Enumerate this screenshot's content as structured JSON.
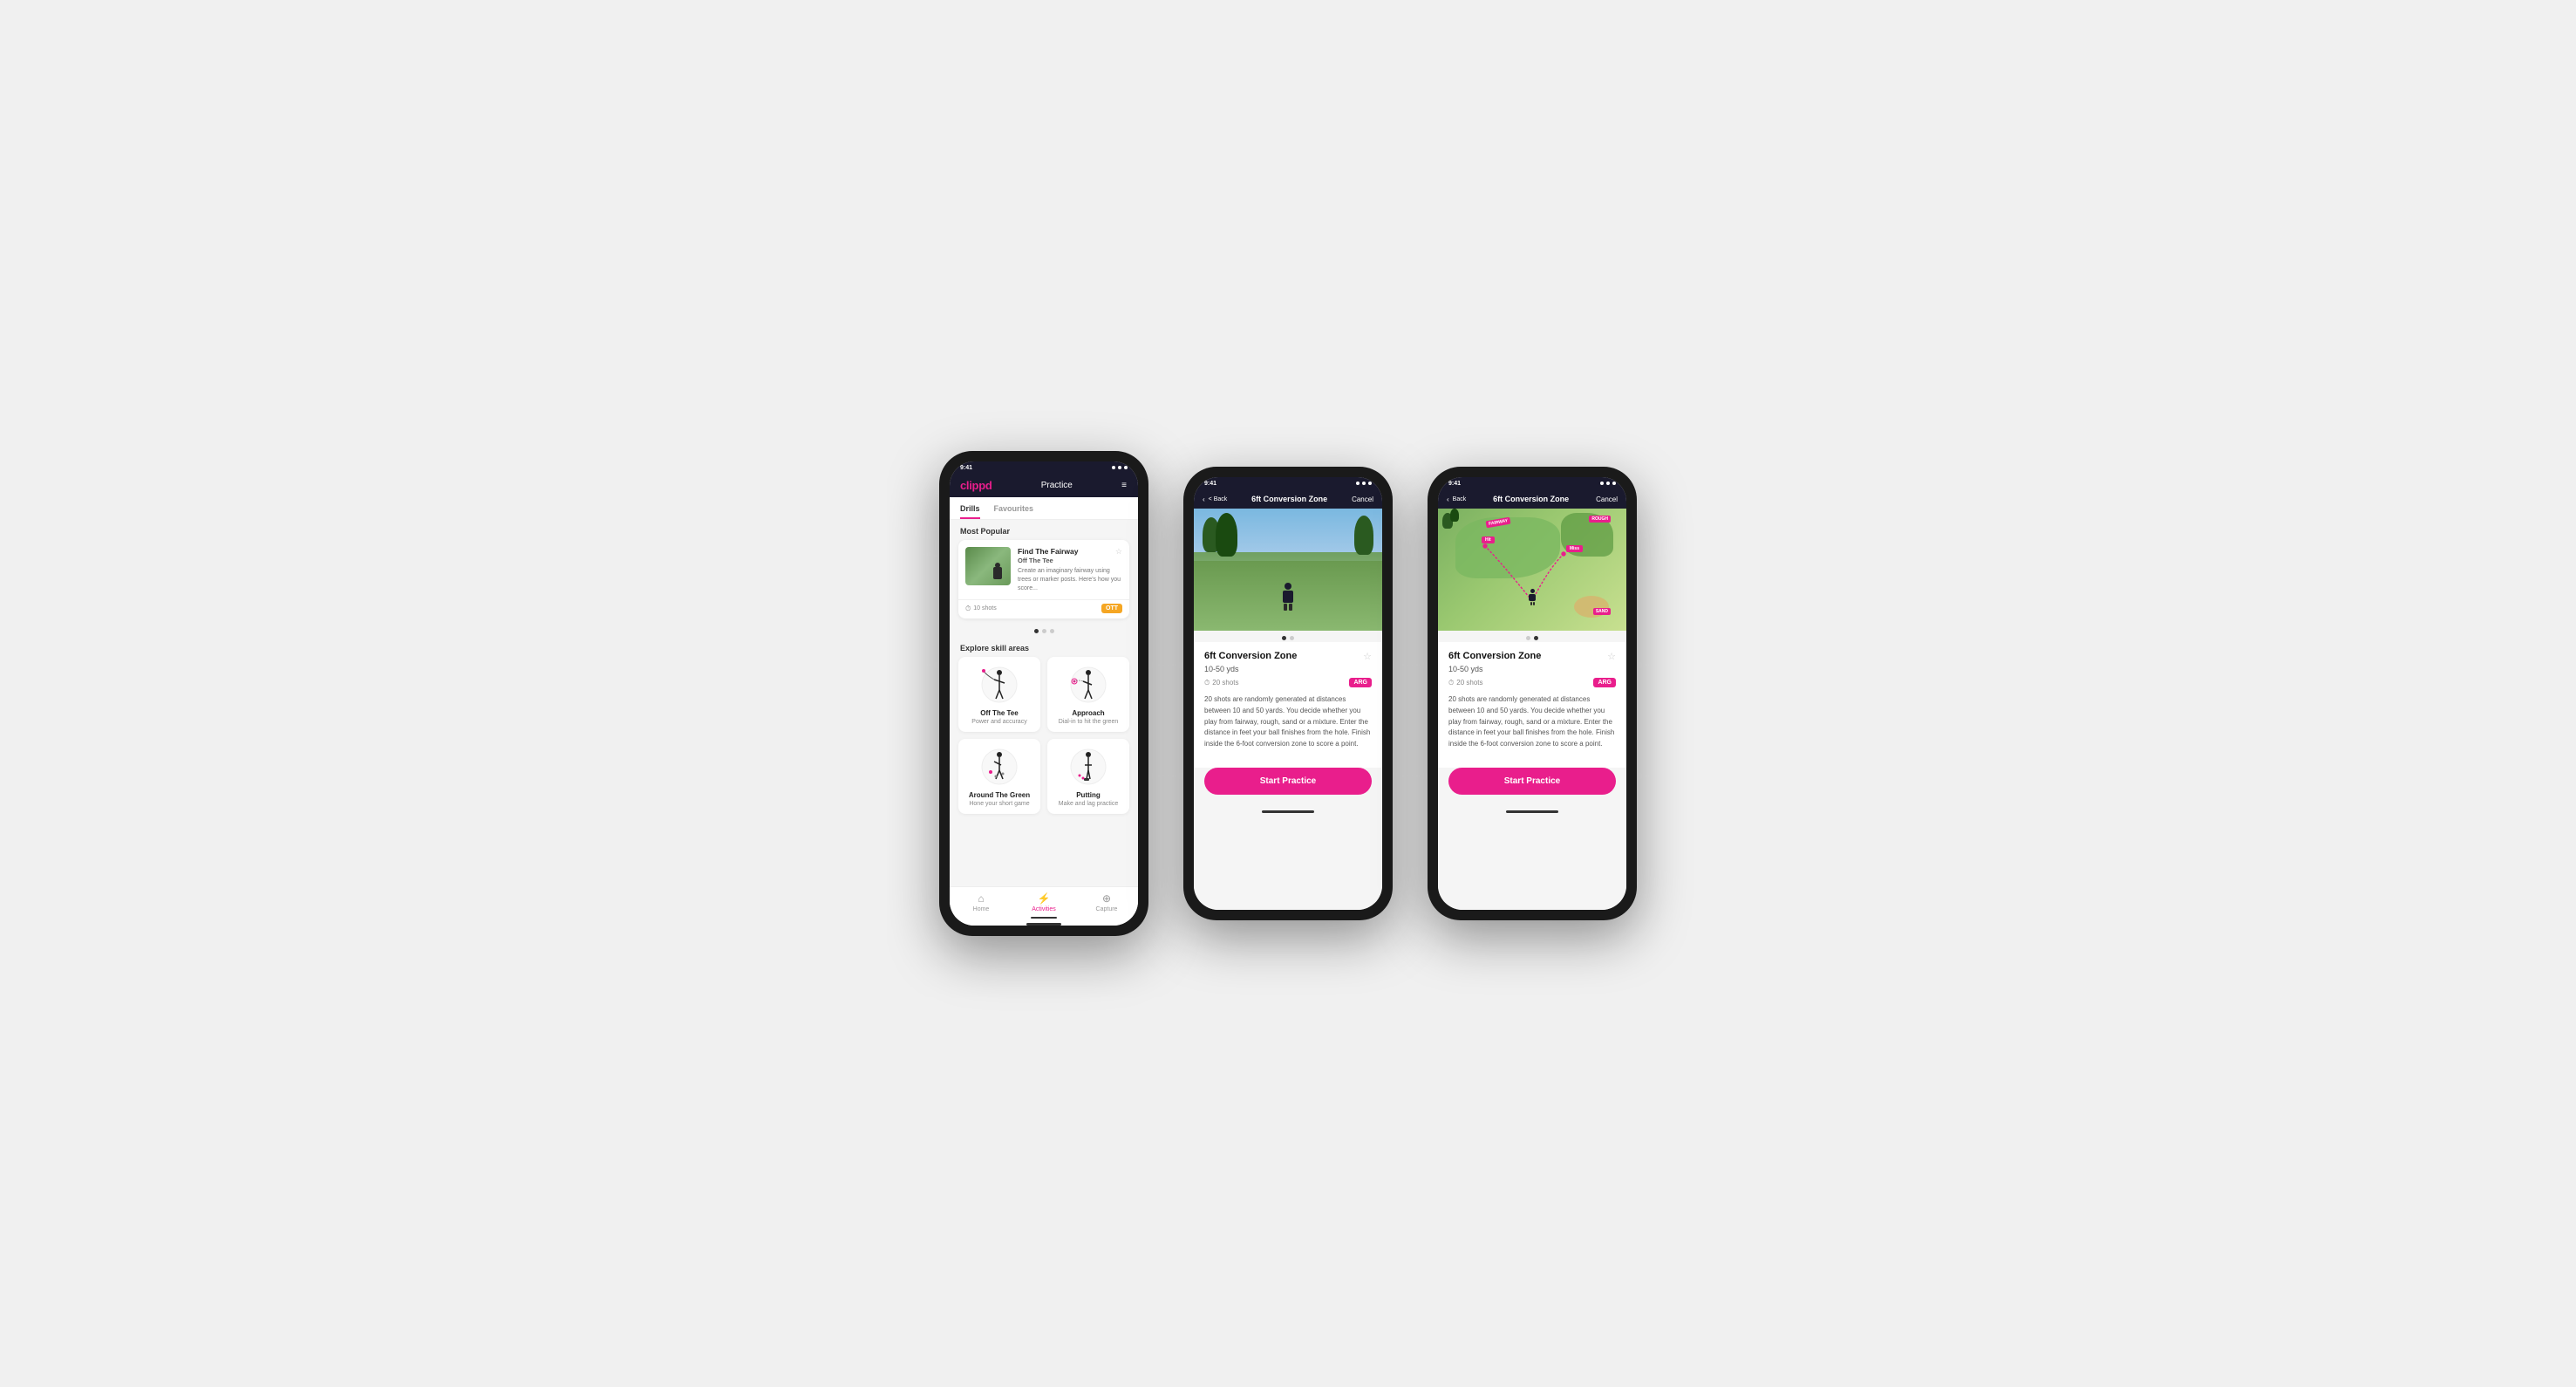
{
  "app": {
    "name": "clippd",
    "accent_color": "#e91e8c"
  },
  "phone1": {
    "header": {
      "logo": "clippd",
      "title": "Practice",
      "menu_icon": "≡"
    },
    "tabs": [
      {
        "label": "Drills",
        "active": true
      },
      {
        "label": "Favourites",
        "active": false
      }
    ],
    "most_popular_label": "Most Popular",
    "featured_drill": {
      "title": "Find The Fairway",
      "subtitle": "Off The Tee",
      "description": "Create an imaginary fairway using trees or marker posts. Here's how you score...",
      "shots": "10 shots",
      "tag": "OTT",
      "tag_color": "#f5a623",
      "fav_icon": "☆"
    },
    "carousel_dots": [
      "active",
      "inactive",
      "inactive"
    ],
    "explore_label": "Explore skill areas",
    "skill_areas": [
      {
        "name": "Off The Tee",
        "desc": "Power and accuracy",
        "icon": "ott"
      },
      {
        "name": "Approach",
        "desc": "Dial-in to hit the green",
        "icon": "approach"
      },
      {
        "name": "Around The Green",
        "desc": "Hone your short game",
        "icon": "atg"
      },
      {
        "name": "Putting",
        "desc": "Make and lag practice",
        "icon": "putting"
      }
    ],
    "nav_items": [
      {
        "label": "Home",
        "icon": "⌂",
        "active": false
      },
      {
        "label": "Activities",
        "icon": "⚡",
        "active": true
      },
      {
        "label": "Capture",
        "icon": "⊕",
        "active": false
      }
    ]
  },
  "phone2": {
    "header": {
      "back_label": "< Back",
      "title": "6ft Conversion Zone",
      "cancel_label": "Cancel"
    },
    "carousel_dots": [
      "active",
      "inactive"
    ],
    "drill": {
      "title": "6ft Conversion Zone",
      "range": "10-50 yds",
      "shots": "20 shots",
      "tag": "ARG",
      "tag_color": "#e91e8c",
      "description": "20 shots are randomly generated at distances between 10 and 50 yards. You decide whether you play from fairway, rough, sand or a mixture. Enter the distance in feet your ball finishes from the hole. Finish inside the 6-foot conversion zone to score a point.",
      "fav_icon": "☆"
    },
    "start_btn": "Start Practice"
  },
  "phone3": {
    "header": {
      "back_label": "< Back",
      "title": "6ft Conversion Zone",
      "cancel_label": "Cancel"
    },
    "carousel_dots": [
      "inactive",
      "active"
    ],
    "drill": {
      "title": "6ft Conversion Zone",
      "range": "10-50 yds",
      "shots": "20 shots",
      "tag": "ARG",
      "tag_color": "#e91e8c",
      "description": "20 shots are randomly generated at distances between 10 and 50 yards. You decide whether you play from fairway, rough, sand or a mixture. Enter the distance in feet your ball finishes from the hole. Finish inside the 6-foot conversion zone to score a point.",
      "fav_icon": "☆",
      "map_labels": [
        "FAIRWAY",
        "ROUGH",
        "SAND",
        "Hit",
        "Miss"
      ]
    },
    "start_btn": "Start Practice"
  }
}
